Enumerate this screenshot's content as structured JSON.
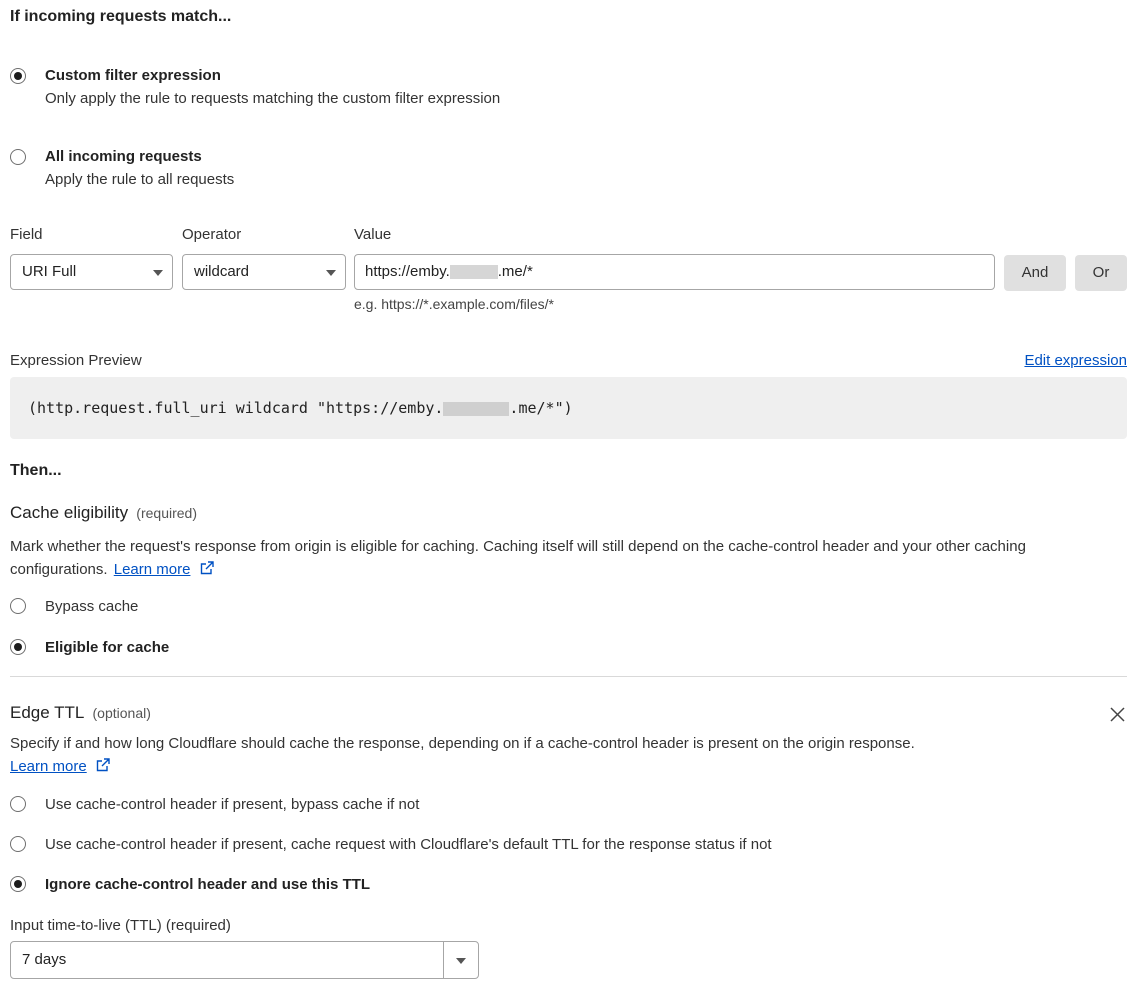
{
  "match": {
    "heading": "If incoming requests match...",
    "options": [
      {
        "title": "Custom filter expression",
        "description": "Only apply the rule to requests matching the custom filter expression",
        "checked": true
      },
      {
        "title": "All incoming requests",
        "description": "Apply the rule to all requests",
        "checked": false
      }
    ]
  },
  "filter": {
    "field_label": "Field",
    "field_value": "URI Full",
    "operator_label": "Operator",
    "operator_value": "wildcard",
    "value_label": "Value",
    "value_prefix": "https://emby.",
    "value_suffix": ".me/*",
    "value_hint": "e.g. https://*.example.com/files/*",
    "and_label": "And",
    "or_label": "Or"
  },
  "preview": {
    "label": "Expression Preview",
    "edit_link": "Edit expression",
    "code_prefix": "(http.request.full_uri wildcard \"https://emby.",
    "code_suffix": ".me/*\")"
  },
  "then": {
    "heading": "Then..."
  },
  "cache_eligibility": {
    "title": "Cache eligibility",
    "qualifier": "(required)",
    "description": "Mark whether the request's response from origin is eligible for caching. Caching itself will still depend on the cache-control header and your other caching configurations.",
    "learn_more": "Learn more",
    "options": [
      {
        "label": "Bypass cache",
        "checked": false
      },
      {
        "label": "Eligible for cache",
        "checked": true
      }
    ]
  },
  "edge_ttl": {
    "title": "Edge TTL",
    "qualifier": "(optional)",
    "description": "Specify if and how long Cloudflare should cache the response, depending on if a cache-control header is present on the origin response.",
    "learn_more": "Learn more",
    "options": [
      {
        "label": "Use cache-control header if present, bypass cache if not",
        "checked": false
      },
      {
        "label": "Use cache-control header if present, cache request with Cloudflare's default TTL for the response status if not",
        "checked": false
      },
      {
        "label": "Ignore cache-control header and use this TTL",
        "checked": true
      }
    ],
    "ttl_label": "Input time-to-live (TTL) (required)",
    "ttl_value": "7 days"
  },
  "icons": {
    "external": "external-link-icon",
    "close": "close-icon",
    "dropdown": "chevron-down-icon"
  }
}
